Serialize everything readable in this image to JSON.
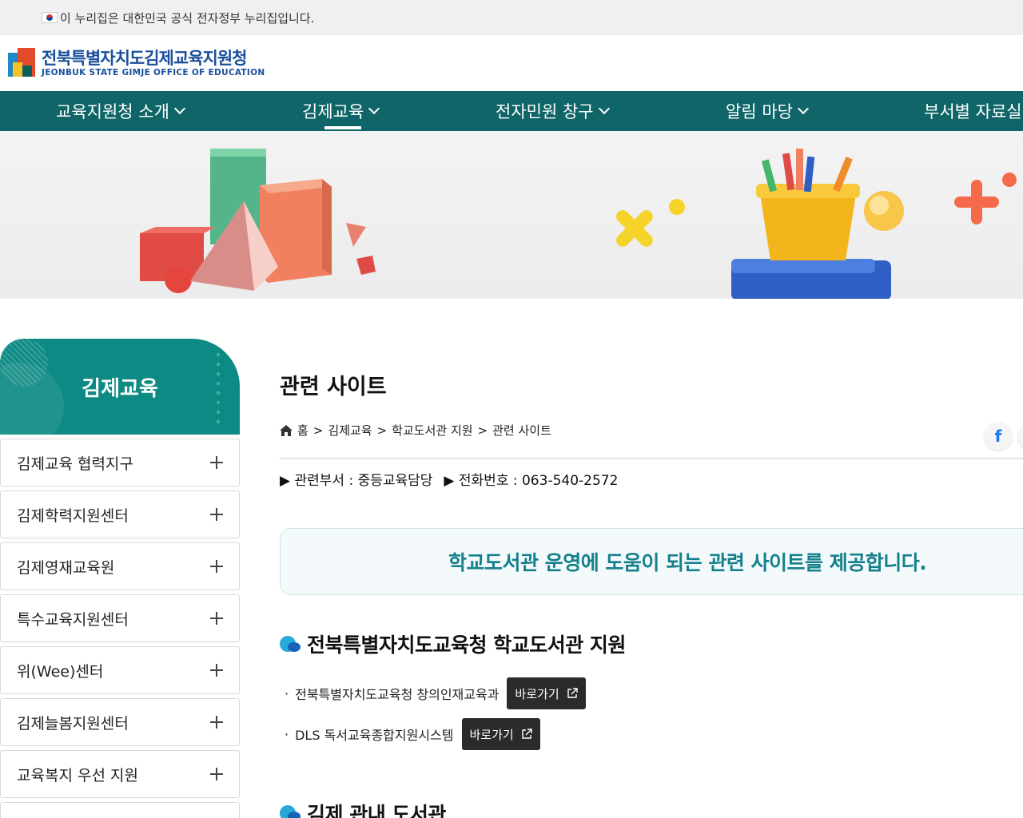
{
  "gov_bar": {
    "text": "이 누리집은 대한민국 공식 전자정부 누리집입니다."
  },
  "logo": {
    "kor": "전북특별자치도김제교육지원청",
    "eng": "JEONBUK STATE GIMJE OFFICE OF EDUCATION"
  },
  "nav": {
    "items": [
      {
        "label": "교육지원청 소개"
      },
      {
        "label": "김제교육"
      },
      {
        "label": "전자민원 창구"
      },
      {
        "label": "알림 마당"
      },
      {
        "label": "부서별 자료실"
      }
    ],
    "active_index": 1
  },
  "sidebar": {
    "title": "김제교육",
    "items": [
      {
        "label": "김제교육 협력지구"
      },
      {
        "label": "김제학력지원센터"
      },
      {
        "label": "김제영재교육원"
      },
      {
        "label": "특수교육지원센터"
      },
      {
        "label": "위(Wee)센터"
      },
      {
        "label": "김제늘봄지원센터"
      },
      {
        "label": "교육복지 우선 지원"
      }
    ]
  },
  "content": {
    "page_title": "관련 사이트",
    "breadcrumb": [
      "홈",
      ">",
      "김제교육",
      ">",
      "학교도서관 지원",
      ">",
      "관련 사이트"
    ],
    "share_facebook": "f",
    "dept": "▶ 관련부서 : 중등교육담당",
    "phone": "▶ 전화번호 : 063-540-2572",
    "notice": "학교도서관 운영에 도움이 되는 관련 사이트를 제공합니다.",
    "section1": {
      "title": "전북특별자치도교육청 학교도서관 지원",
      "links": [
        {
          "label": "전북특별자치도교육청 창의인재교육과",
          "button": "바로가기"
        },
        {
          "label": "DLS 독서교육종합지원시스템",
          "button": "바로가기"
        }
      ]
    },
    "section2": {
      "title": "김제 관내 도서관"
    },
    "bullet": "·"
  },
  "colors": {
    "nav_bg": "#0f6567",
    "sidebar_head": "#0e8a84",
    "notice_text": "#14808c",
    "button_bg": "#2b2b2b"
  }
}
